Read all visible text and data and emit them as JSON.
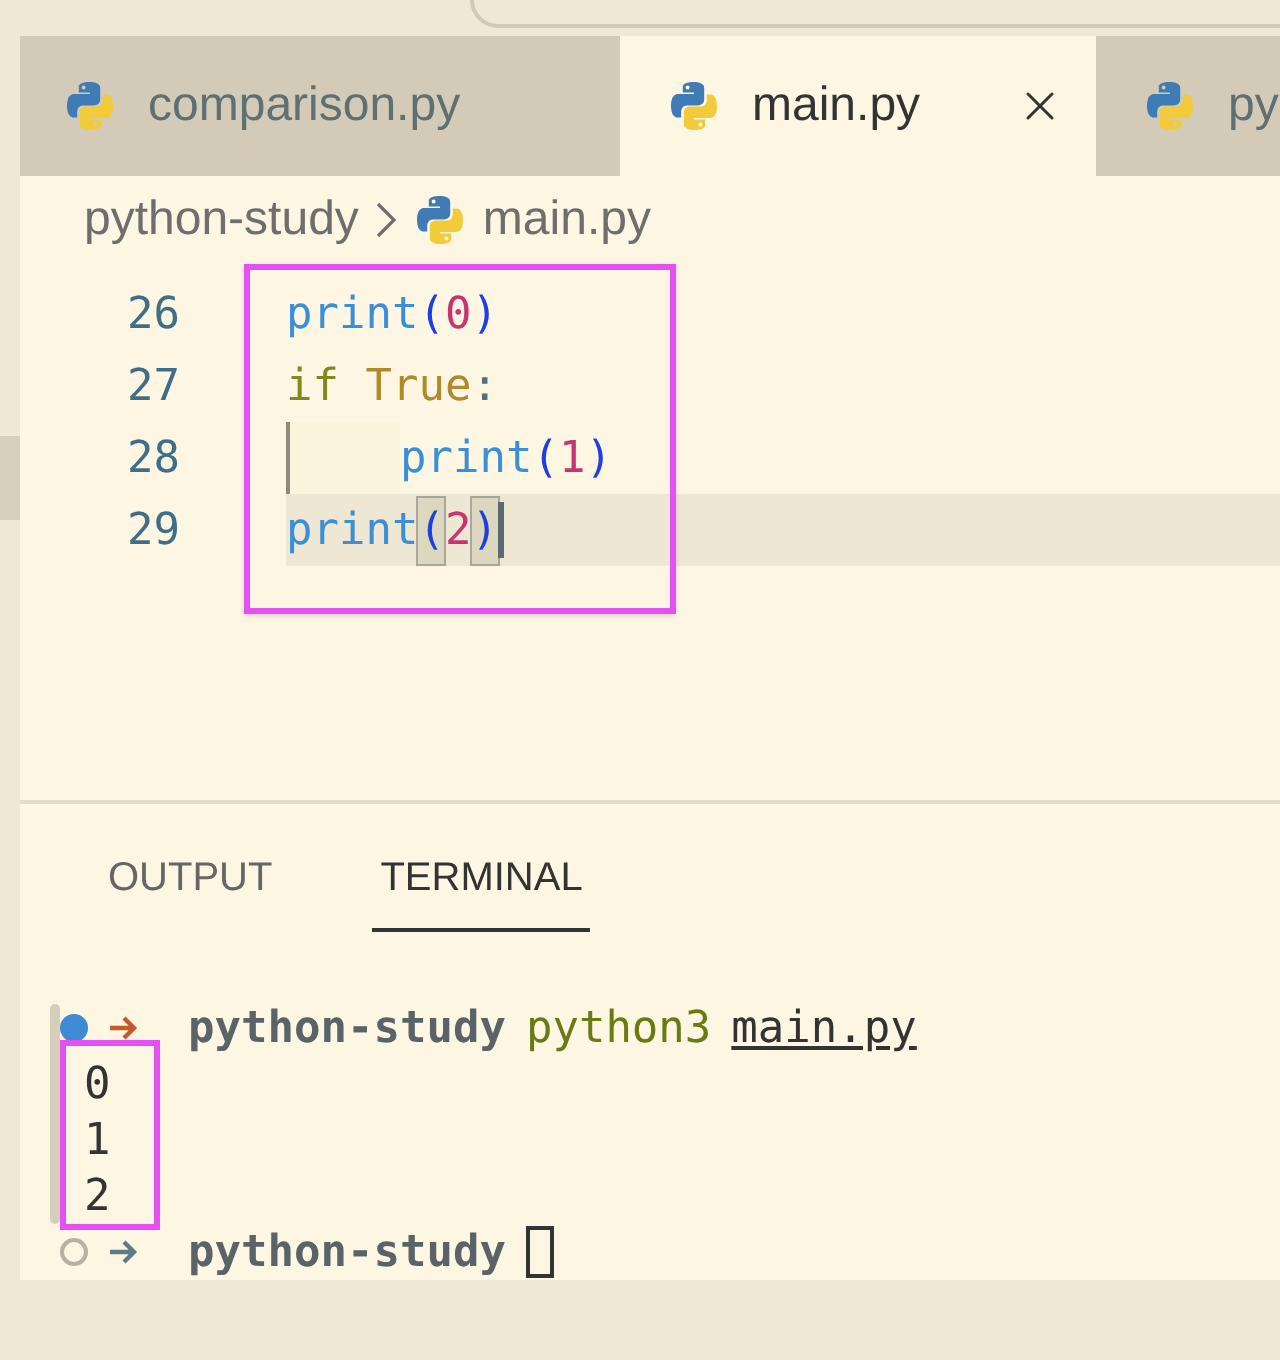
{
  "tabs": [
    {
      "label": "comparison.py",
      "selected": false,
      "closable": false
    },
    {
      "label": "main.py",
      "selected": true,
      "closable": true
    },
    {
      "label": "py",
      "selected": false,
      "closable": false
    }
  ],
  "breadcrumb": [
    "python-study",
    "main.py"
  ],
  "editor": {
    "lines": [
      {
        "number": "26",
        "current": false,
        "indented": false,
        "tokens": [
          {
            "kind": "function",
            "text": "print"
          },
          {
            "kind": "paren",
            "text": "(",
            "matched": false
          },
          {
            "kind": "number",
            "text": "0"
          },
          {
            "kind": "paren",
            "text": ")",
            "matched": false
          }
        ]
      },
      {
        "number": "27",
        "current": false,
        "indented": false,
        "tokens": [
          {
            "kind": "keyword",
            "text": "if "
          },
          {
            "kind": "constant",
            "text": "True"
          },
          {
            "kind": "punct",
            "text": ":"
          }
        ]
      },
      {
        "number": "28",
        "current": false,
        "indented": true,
        "tokens": [
          {
            "kind": "function",
            "text": "print"
          },
          {
            "kind": "paren",
            "text": "(",
            "matched": false
          },
          {
            "kind": "number",
            "text": "1"
          },
          {
            "kind": "paren",
            "text": ")",
            "matched": false
          }
        ]
      },
      {
        "number": "29",
        "current": true,
        "indented": false,
        "tokens": [
          {
            "kind": "function",
            "text": "print"
          },
          {
            "kind": "paren",
            "text": "(",
            "matched": true
          },
          {
            "kind": "number",
            "text": "2"
          },
          {
            "kind": "paren",
            "text": ")",
            "matched": true
          }
        ]
      }
    ]
  },
  "panel_tabs": [
    {
      "label": "OUTPUT",
      "selected": false
    },
    {
      "label": "TERMINAL",
      "selected": true
    }
  ],
  "terminal": [
    {
      "kind": "prompt",
      "succeeded": true,
      "dir": "python-study",
      "command": "python3",
      "arg": "main.py",
      "cursor": false
    },
    {
      "kind": "output",
      "text": "0"
    },
    {
      "kind": "output",
      "text": "1"
    },
    {
      "kind": "output",
      "text": "2"
    },
    {
      "kind": "prompt",
      "succeeded": false,
      "dir": "python-study",
      "cursor": true
    }
  ]
}
